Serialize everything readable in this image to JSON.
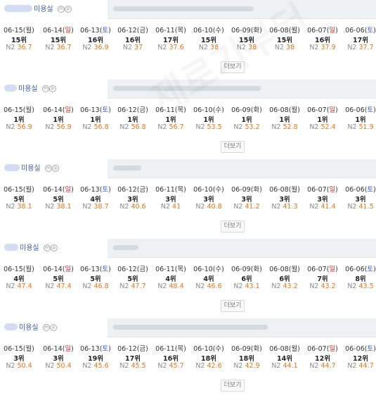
{
  "more_label": "더보기",
  "watermark": "제로기부터",
  "score_prefix": "N2",
  "colors": {
    "score": "#e8761c",
    "saturday": "#2a55c9",
    "sunday": "#e02b2b",
    "shop_link": "#3a5aa8"
  },
  "blocks": [
    {
      "shop_label": "미용실",
      "badges": [
        "m",
        "p"
      ],
      "days": [
        {
          "date": "06-15",
          "dow": "월",
          "rank": "15위",
          "score": "36.7"
        },
        {
          "date": "06-14",
          "dow": "일",
          "rank": "15위",
          "score": "36.7"
        },
        {
          "date": "06-13",
          "dow": "토",
          "rank": "16위",
          "score": "36.9"
        },
        {
          "date": "06-12",
          "dow": "금",
          "rank": "16위",
          "score": "37"
        },
        {
          "date": "06-11",
          "dow": "목",
          "rank": "17위",
          "score": "37.6"
        },
        {
          "date": "06-10",
          "dow": "수",
          "rank": "15위",
          "score": "38"
        },
        {
          "date": "06-09",
          "dow": "화",
          "rank": "15위",
          "score": "38"
        },
        {
          "date": "06-08",
          "dow": "월",
          "rank": "15위",
          "score": "38"
        },
        {
          "date": "06-07",
          "dow": "일",
          "rank": "16위",
          "score": "37.9"
        },
        {
          "date": "06-06",
          "dow": "토",
          "rank": "17위",
          "score": "37.7"
        }
      ]
    },
    {
      "shop_label": "미용실",
      "badges": [
        "m",
        "p"
      ],
      "days": [
        {
          "date": "06-15",
          "dow": "월",
          "rank": "1위",
          "score": "56.9"
        },
        {
          "date": "06-14",
          "dow": "일",
          "rank": "1위",
          "score": "56.9"
        },
        {
          "date": "06-13",
          "dow": "토",
          "rank": "1위",
          "score": "56.8"
        },
        {
          "date": "06-12",
          "dow": "금",
          "rank": "1위",
          "score": "56.8"
        },
        {
          "date": "06-11",
          "dow": "목",
          "rank": "1위",
          "score": "56.7"
        },
        {
          "date": "06-10",
          "dow": "수",
          "rank": "1위",
          "score": "53.5"
        },
        {
          "date": "06-09",
          "dow": "화",
          "rank": "1위",
          "score": "53.2"
        },
        {
          "date": "06-08",
          "dow": "월",
          "rank": "1위",
          "score": "52.8"
        },
        {
          "date": "06-07",
          "dow": "일",
          "rank": "1위",
          "score": "52.4"
        },
        {
          "date": "06-06",
          "dow": "토",
          "rank": "1위",
          "score": "51.9"
        }
      ]
    },
    {
      "shop_label": "미용실",
      "badges": [
        "m",
        "p"
      ],
      "days": [
        {
          "date": "06-15",
          "dow": "월",
          "rank": "5위",
          "score": "38.1"
        },
        {
          "date": "06-14",
          "dow": "일",
          "rank": "5위",
          "score": "38.1"
        },
        {
          "date": "06-13",
          "dow": "토",
          "rank": "4위",
          "score": "38.7"
        },
        {
          "date": "06-12",
          "dow": "금",
          "rank": "3위",
          "score": "40.6"
        },
        {
          "date": "06-11",
          "dow": "목",
          "rank": "3위",
          "score": "41"
        },
        {
          "date": "06-10",
          "dow": "수",
          "rank": "3위",
          "score": "40.8"
        },
        {
          "date": "06-09",
          "dow": "화",
          "rank": "3위",
          "score": "41.2"
        },
        {
          "date": "06-08",
          "dow": "월",
          "rank": "3위",
          "score": "41.3"
        },
        {
          "date": "06-07",
          "dow": "일",
          "rank": "3위",
          "score": "41.4"
        },
        {
          "date": "06-06",
          "dow": "토",
          "rank": "3위",
          "score": "41.5"
        }
      ]
    },
    {
      "shop_label": "미용실",
      "badges": [
        "m",
        "p"
      ],
      "days": [
        {
          "date": "06-15",
          "dow": "월",
          "rank": "4위",
          "score": "47.4"
        },
        {
          "date": "06-14",
          "dow": "일",
          "rank": "5위",
          "score": "47.4"
        },
        {
          "date": "06-13",
          "dow": "토",
          "rank": "5위",
          "score": "46.8"
        },
        {
          "date": "06-12",
          "dow": "금",
          "rank": "5위",
          "score": "47.7"
        },
        {
          "date": "06-11",
          "dow": "목",
          "rank": "4위",
          "score": "48.4"
        },
        {
          "date": "06-10",
          "dow": "수",
          "rank": "4위",
          "score": "46.6"
        },
        {
          "date": "06-09",
          "dow": "화",
          "rank": "6위",
          "score": "43.1"
        },
        {
          "date": "06-08",
          "dow": "월",
          "rank": "6위",
          "score": "43.2"
        },
        {
          "date": "06-07",
          "dow": "일",
          "rank": "7위",
          "score": "43.2"
        },
        {
          "date": "06-06",
          "dow": "토",
          "rank": "8위",
          "score": "43.5"
        }
      ]
    },
    {
      "shop_label": "미용실",
      "badges": [
        "m",
        "p"
      ],
      "days": [
        {
          "date": "06-15",
          "dow": "월",
          "rank": "3위",
          "score": "50.4"
        },
        {
          "date": "06-14",
          "dow": "일",
          "rank": "3위",
          "score": "50.4"
        },
        {
          "date": "06-13",
          "dow": "토",
          "rank": "19위",
          "score": "45.6"
        },
        {
          "date": "06-12",
          "dow": "금",
          "rank": "17위",
          "score": "45.5"
        },
        {
          "date": "06-11",
          "dow": "목",
          "rank": "16위",
          "score": "45.7"
        },
        {
          "date": "06-10",
          "dow": "수",
          "rank": "18위",
          "score": "42.6"
        },
        {
          "date": "06-09",
          "dow": "화",
          "rank": "18위",
          "score": "42.9"
        },
        {
          "date": "06-08",
          "dow": "월",
          "rank": "14위",
          "score": "44.1"
        },
        {
          "date": "06-07",
          "dow": "일",
          "rank": "12위",
          "score": "44.7"
        },
        {
          "date": "06-06",
          "dow": "토",
          "rank": "12위",
          "score": "44.7"
        }
      ]
    }
  ]
}
